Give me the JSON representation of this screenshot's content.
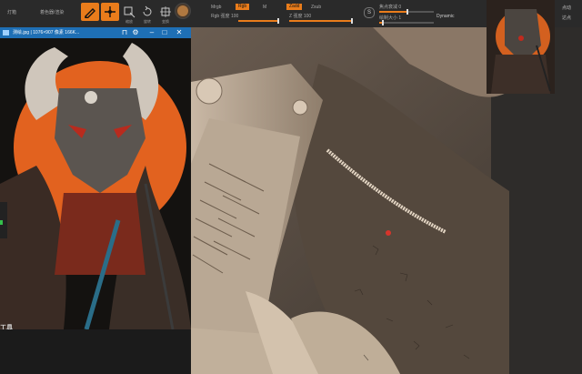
{
  "toolbar": {
    "menu_label": "灯箱",
    "preview_label": "着色器/渲染",
    "tools": [
      {
        "icon": "edit-icon",
        "caption": "",
        "active": true
      },
      {
        "icon": "move-icon",
        "caption": "",
        "active": true
      },
      {
        "icon": "scale-icon",
        "caption": "缩放",
        "active": false
      },
      {
        "icon": "rotate-icon",
        "caption": "旋转",
        "active": false
      },
      {
        "icon": "transform-icon",
        "caption": "变换",
        "active": false
      }
    ],
    "mrgb_label": "Mrgb",
    "rgb_tag": "Rgb",
    "m_label": "M",
    "rgb_intensity_label": "Rgb 强度 100",
    "zadd_tag": "Zadd",
    "zsub_label": "Zsub",
    "z_intensity_label": "Z 强度 100",
    "focal_shift_label": "焦点衰减 0",
    "draw_size_label": "绘制大小 1",
    "dynamic_label": "Dynamic",
    "s_badge": "S",
    "right_labels": [
      "点动",
      "达点"
    ],
    "colors": {
      "accent": "#e97c1b",
      "title_blue": "#1e6fb5"
    }
  },
  "reference_window": {
    "title": "测绘.jpg | 1076×907 像素 166K...",
    "watermark_line1": "工具",
    "watermark_line2": "俄机",
    "controls": [
      "minimize-icon",
      "maximize-icon",
      "close-icon"
    ]
  },
  "canvas": {
    "description_free": ""
  }
}
